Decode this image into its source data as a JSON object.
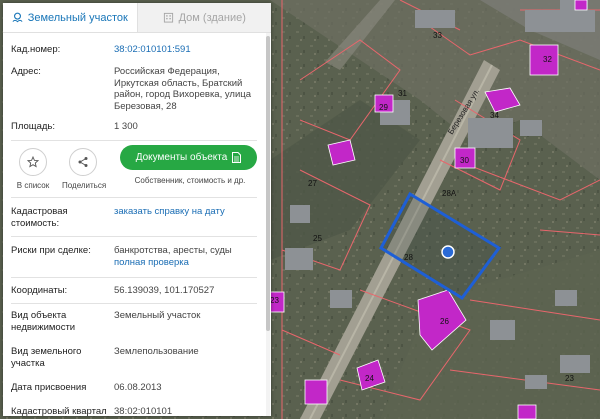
{
  "tabs": [
    {
      "label": "Земельный участок",
      "icon": "map-pin-icon",
      "active": true
    },
    {
      "label": "Дом (здание)",
      "icon": "building-icon",
      "active": false
    }
  ],
  "info": {
    "cad_number": {
      "label": "Кад.номер:",
      "value": "38:02:010101:591"
    },
    "address": {
      "label": "Адрес:",
      "value": "Российская Федерация, Иркутская область, Братский район, город Вихоревка, улица Березовая, 28"
    },
    "area": {
      "label": "Площадь:",
      "value": "1 300"
    },
    "cad_value": {
      "label": "Кадастровая стоимость:",
      "link": "заказать справку на дату"
    },
    "risks": {
      "label": "Риски при сделке:",
      "value": "банкротства, аресты, суды",
      "link": "полная проверка"
    },
    "coords": {
      "label": "Координаты:",
      "value": "56.139039, 101.170527"
    },
    "object_type": {
      "label": "Вид объекта недвижимости",
      "value": "Земельный участок"
    },
    "land_type": {
      "label": "Вид земельного участка",
      "value": "Землепользование"
    },
    "date": {
      "label": "Дата присвоения",
      "value": "06.08.2013"
    },
    "quarter": {
      "label": "Кадастровый квартал",
      "value": "38:02:010101"
    }
  },
  "actions": {
    "to_list": {
      "label": "В список",
      "icon": "star-icon"
    },
    "share": {
      "label": "Поделиться",
      "icon": "share-icon"
    },
    "documents": {
      "label": "Документы объекта",
      "icon": "document-icon",
      "sublabel": "Собственник, стоимость и др."
    }
  },
  "map": {
    "street_label": "Березовая ул.",
    "parcel_labels": [
      "32",
      "33",
      "31",
      "29",
      "34",
      "30",
      "28А",
      "27",
      "25",
      "28",
      "23",
      "26",
      "24",
      "23"
    ],
    "colors": {
      "selected_parcel": "#1e5fd6",
      "building_highlight": "#c227c8",
      "parcel_border": "#e8666c",
      "accent_green": "#27a844",
      "link_blue": "#1a6db4"
    }
  }
}
